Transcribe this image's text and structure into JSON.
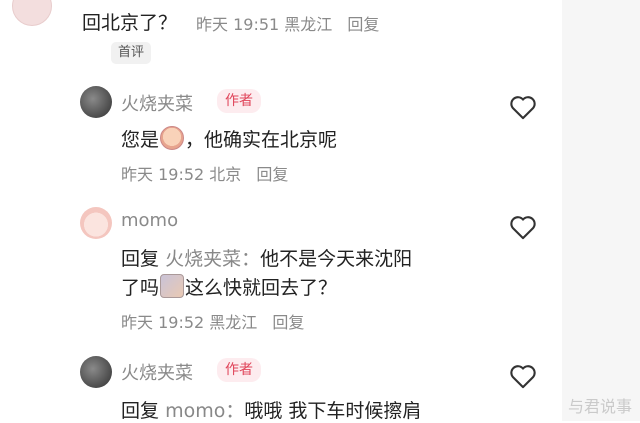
{
  "comments": [
    {
      "text": "回北京了？",
      "time": "昨天 19:51",
      "location": "黑龙江",
      "reply_label": "回复",
      "badge": "首评"
    },
    {
      "username": "火烧夹菜",
      "badge": "作者",
      "text_before_emoji": "您是",
      "emoji_icon": "crying-face-icon",
      "text_after_emoji": "，他确实在北京呢",
      "time": "昨天 19:52",
      "location": "北京",
      "reply_label": "回复"
    },
    {
      "username": "momo",
      "reply_prefix": "回复",
      "reply_to": "火烧夹菜：",
      "text_line1": "他不是今天来沈阳",
      "text_line2_before": "了吗",
      "emoji_icon": "facepalm-sticker-icon",
      "text_line2_after": "这么快就回去了？",
      "time": "昨天 19:52",
      "location": "黑龙江",
      "reply_label": "回复"
    },
    {
      "username": "火烧夹菜",
      "badge": "作者",
      "reply_prefix": "回复",
      "reply_to": "momo：",
      "text": "哦哦 我下车时候擦肩"
    }
  ],
  "watermark": "与君说事",
  "colors": {
    "badge_author_text": "#e0455a",
    "badge_author_bg": "#fdecef",
    "meta_text": "#8a8a8a"
  }
}
